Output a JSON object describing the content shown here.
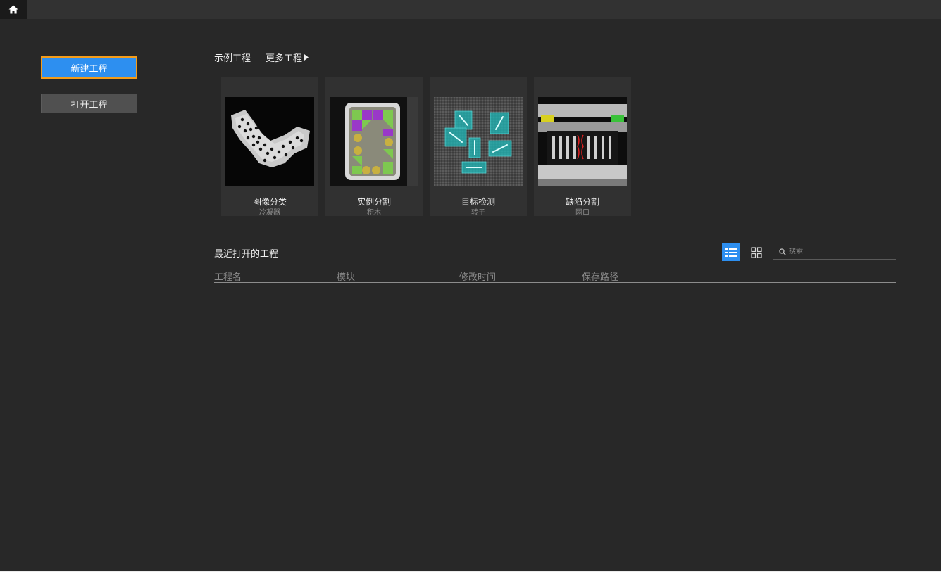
{
  "sidebar": {
    "new_project": "新建工程",
    "open_project": "打开工程"
  },
  "examples": {
    "title": "示例工程",
    "more": "更多工程",
    "cards": [
      {
        "title": "图像分类",
        "subtitle": "冷凝器"
      },
      {
        "title": "实例分割",
        "subtitle": "积木"
      },
      {
        "title": "目标检测",
        "subtitle": "转子"
      },
      {
        "title": "缺陷分割",
        "subtitle": "网口"
      }
    ]
  },
  "recent": {
    "title": "最近打开的工程",
    "search_placeholder": "搜索",
    "columns": [
      "工程名",
      "模块",
      "修改时间",
      "保存路径"
    ],
    "rows": []
  },
  "colors": {
    "accent": "#2d8ff0",
    "focus_border": "#f39c1a",
    "background": "#282828"
  }
}
